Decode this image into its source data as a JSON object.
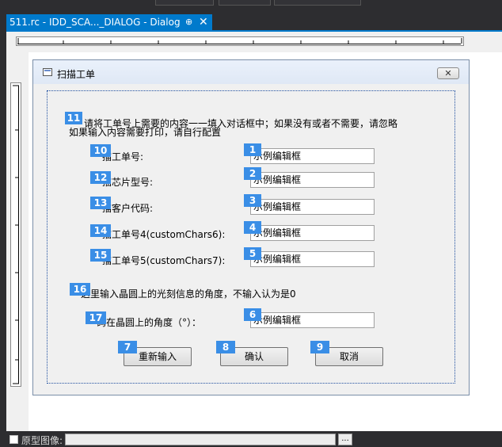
{
  "document_tab": {
    "title": "511.rc - IDD_SCA..._DIALOG - Dialog",
    "pin_icon": "pin-icon",
    "close_icon": "close-icon"
  },
  "dialog": {
    "title": "扫描工单",
    "close_glyph": "✕",
    "instruction_line1": "请将工单号上需要的内容一一填入对话框中；如果没有或者不需要，请忽略",
    "instruction_line2": "如果输入内容需要打印，请自行配置",
    "fields": [
      {
        "label": "描工单号:",
        "value": "示例编辑框"
      },
      {
        "label": "描芯片型号:",
        "value": "示例编辑框"
      },
      {
        "label": "描客户代码:",
        "value": "示例编辑框"
      },
      {
        "label": "描工单号4(customChars6):",
        "value": "示例编辑框"
      },
      {
        "label": "描工单号5(customChars7):",
        "value": "示例编辑框"
      }
    ],
    "angle_note": "这里输入晶圆上的光刻信息的角度，不输入认为是0",
    "angle_field": {
      "label": "码在晶圆上的角度（°）：",
      "value": "示例编辑框"
    },
    "buttons": {
      "reset": "重新输入",
      "confirm": "确认",
      "cancel": "取消"
    }
  },
  "badges": [
    "1",
    "2",
    "3",
    "4",
    "5",
    "6",
    "7",
    "8",
    "9",
    "10",
    "11",
    "12",
    "13",
    "14",
    "15",
    "16",
    "17"
  ],
  "bottom_bar": {
    "checkbox_label": "原型图像:",
    "browse_label": "..."
  },
  "colors": {
    "accent": "#007acc",
    "badge": "#3a8ee6",
    "dark_bg": "#2d2d30",
    "dialog_bg": "#f0f0f0"
  }
}
